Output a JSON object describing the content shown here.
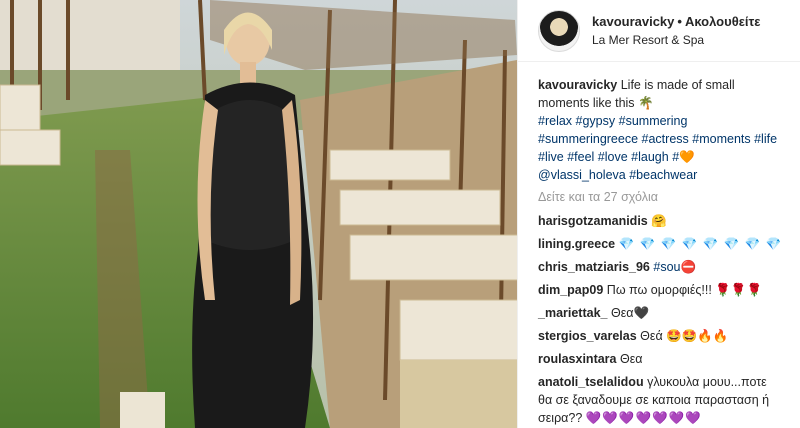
{
  "post": {
    "author": "kavouravicky",
    "separator": "•",
    "follow_label": "Ακολουθείτε",
    "location": "La Mer Resort & Spa",
    "caption_text": "Life is made of small moments like this",
    "caption_emoji": "🌴",
    "hashtags": [
      "#relax",
      "#gypsy",
      "#summering",
      "#summeringreece",
      "#actress",
      "#moments",
      "#life",
      "#live",
      "#feel",
      "#love",
      "#laugh",
      "#"
    ],
    "caption_heart": "🧡",
    "mention": "@vlassi_holeva",
    "last_hashtag": "#beachwear",
    "view_all": "Δείτε και τα 27 σχόλια"
  },
  "comments": [
    {
      "user": "harisgotzamanidis",
      "text": "",
      "emoji": "🤗",
      "emoji_class": "face"
    },
    {
      "user": "lining.greece",
      "text": "",
      "emoji": "💎 💎 💎 💎 💎 💎 💎 💎",
      "emoji_class": "gem"
    },
    {
      "user": "chris_matziaris_96",
      "text": "#sou",
      "emoji": "⛔",
      "emoji_class": "stop"
    },
    {
      "user": "dim_pap09",
      "text": "Πω πω ομορφιές!!!",
      "emoji": "🌹🌹🌹",
      "emoji_class": "rose"
    },
    {
      "user": "_mariettak_",
      "text": "Θεα",
      "emoji": "🖤",
      "emoji_class": ""
    },
    {
      "user": "stergios_varelas",
      "text": "Θεά",
      "emoji": "🤩🤩🔥🔥",
      "emoji_class": "fire"
    },
    {
      "user": "roulasxintara",
      "text": "Θεα",
      "emoji": "",
      "emoji_class": ""
    },
    {
      "user": "anatoli_tselalidou",
      "text": "γλυκουλα μουυ...ποτε θα σε ξαναδουμε σε καποια παρασταση ή σειρα??",
      "emoji": "💜💜💜💜💜💜💜",
      "emoji_class": "purple"
    }
  ]
}
